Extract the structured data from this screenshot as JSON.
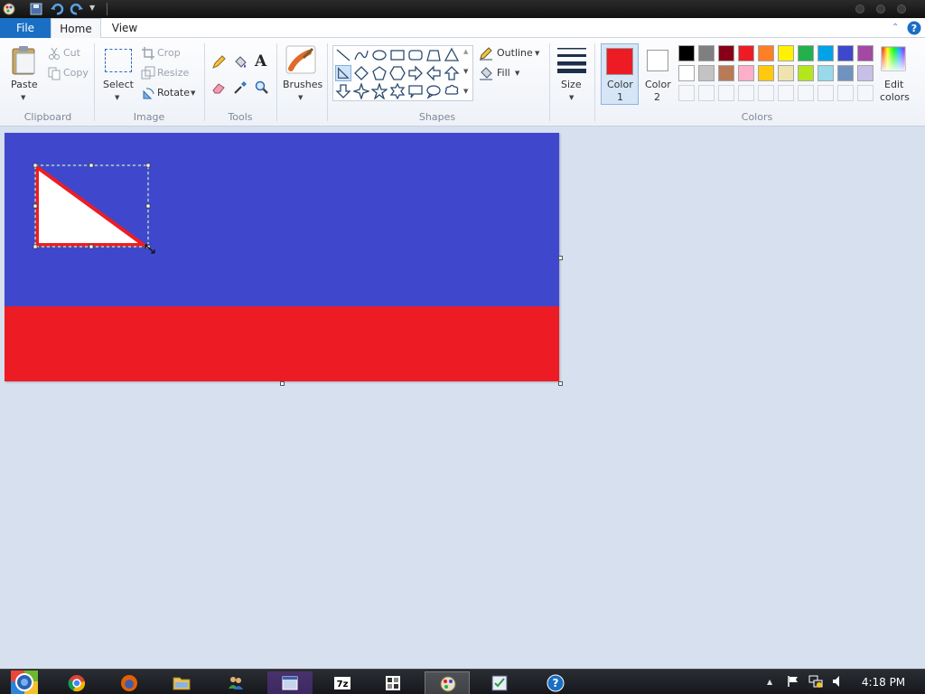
{
  "tabs": {
    "file": "File",
    "home": "Home",
    "view": "View"
  },
  "clipboard": {
    "paste": "Paste",
    "cut": "Cut",
    "copy": "Copy",
    "label": "Clipboard"
  },
  "image": {
    "select": "Select",
    "crop": "Crop",
    "resize": "Resize",
    "rotate": "Rotate",
    "label": "Image"
  },
  "tools": {
    "label": "Tools"
  },
  "brushes": {
    "label": "Brushes"
  },
  "shapes": {
    "outline": "Outline",
    "fill": "Fill",
    "label": "Shapes"
  },
  "size": {
    "label": "Size"
  },
  "colors": {
    "color1_label": "Color",
    "color1_sub": "1",
    "color2_label": "Color",
    "color2_sub": "2",
    "edit_label": "Edit",
    "edit_sub": "colors",
    "label": "Colors",
    "color1_value": "#ed1c24",
    "color2_value": "#ffffff",
    "palette_row1": [
      "#000000",
      "#7f7f7f",
      "#880015",
      "#ed1c24",
      "#ff7f27",
      "#fff200",
      "#22b14c",
      "#00a2e8",
      "#3f48cc",
      "#a349a4"
    ],
    "palette_row2": [
      "#ffffff",
      "#c3c3c3",
      "#b97a57",
      "#ffaec9",
      "#ffc90e",
      "#efe4b0",
      "#b5e61d",
      "#99d9ea",
      "#7092be",
      "#c8bfe7"
    ]
  },
  "canvas_colors": {
    "top": "#3f48cc",
    "bottom": "#ed1c24",
    "triangle_fill": "#ffffff",
    "triangle_outline": "#ed1c24"
  },
  "taskbar": {
    "time": "4:18 PM"
  }
}
